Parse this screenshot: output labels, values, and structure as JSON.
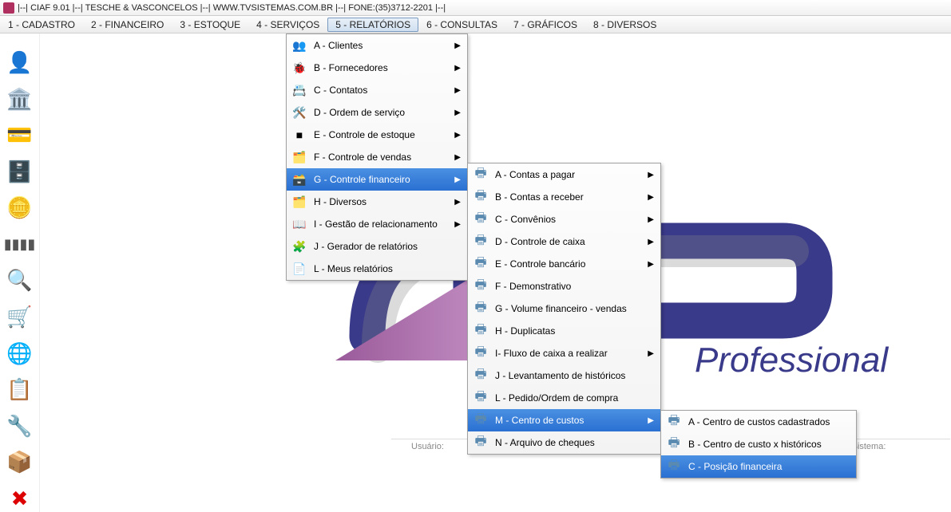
{
  "title": "|--| CIAF 9.01 |--| TESCHE & VASCONCELOS |--| WWW.TVSISTEMAS.COM.BR |--| FONE:(35)3712-2201 |--|",
  "menubar": [
    "1 - CADASTRO",
    "2 - FINANCEIRO",
    "3 - ESTOQUE",
    "4 - SERVIÇOS",
    "5 - RELATÓRIOS",
    "6 - CONSULTAS",
    "7 - GRÁFICOS",
    "8 - DIVERSOS"
  ],
  "submenu1": [
    {
      "label": "A - Clientes",
      "arrow": true
    },
    {
      "label": "B - Fornecedores",
      "arrow": true
    },
    {
      "label": "C - Contatos",
      "arrow": true
    },
    {
      "label": "D - Ordem de serviço",
      "arrow": true
    },
    {
      "label": "E - Controle de estoque",
      "arrow": true
    },
    {
      "label": "F - Controle de vendas",
      "arrow": true
    },
    {
      "label": "G - Controle financeiro",
      "arrow": true,
      "highlighted": true
    },
    {
      "label": "H - Diversos",
      "arrow": true
    },
    {
      "label": "I - Gestão de relacionamento",
      "arrow": true
    },
    {
      "label": "J - Gerador de relatórios",
      "arrow": false
    },
    {
      "label": "L - Meus relatórios",
      "arrow": false
    }
  ],
  "submenu2": [
    {
      "label": "A - Contas a pagar",
      "arrow": true
    },
    {
      "label": "B - Contas a receber",
      "arrow": true
    },
    {
      "label": "C - Convênios",
      "arrow": true
    },
    {
      "label": "D - Controle de caixa",
      "arrow": true
    },
    {
      "label": "E - Controle bancário",
      "arrow": true
    },
    {
      "label": "F - Demonstrativo",
      "arrow": false
    },
    {
      "label": "G - Volume financeiro - vendas",
      "arrow": false
    },
    {
      "label": "H - Duplicatas",
      "arrow": false
    },
    {
      "label": "I- Fluxo de caixa a realizar",
      "arrow": true
    },
    {
      "label": "J - Levantamento de históricos",
      "arrow": false
    },
    {
      "label": "L - Pedido/Ordem de compra",
      "arrow": false
    },
    {
      "label": "M - Centro de custos",
      "arrow": true,
      "highlighted": true
    },
    {
      "label": "N - Arquivo de cheques",
      "arrow": false
    }
  ],
  "submenu3": [
    {
      "label": "A - Centro de custos cadastrados",
      "arrow": false
    },
    {
      "label": "B - Centro de custo x históricos",
      "arrow": false
    },
    {
      "label": "C - Posição financeira",
      "arrow": false,
      "highlighted": true
    }
  ],
  "labels": {
    "usuario": "Usuário:",
    "data_sistema": "Data do Sistema:",
    "logo": "Professional"
  },
  "toolbar_icons": [
    "person-icon",
    "bank-icon",
    "cashreg-icon",
    "safe-icon",
    "coins-icon",
    "barcode-icon",
    "search-icon",
    "cart-icon",
    "nfe-icon",
    "note-icon",
    "tool-icon",
    "box-icon",
    "close-icon"
  ]
}
